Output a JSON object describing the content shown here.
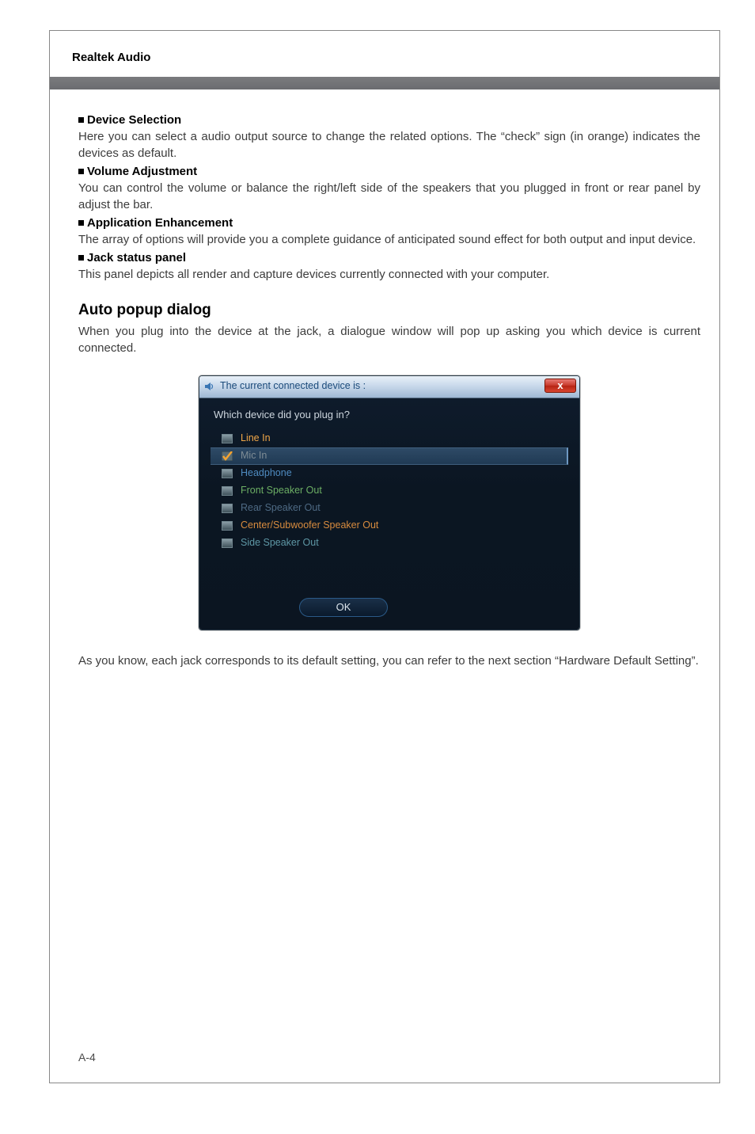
{
  "doc": {
    "title": "Realtek Audio",
    "pageNumber": "A-4"
  },
  "sections": {
    "deviceSelection": {
      "heading": "Device Selection",
      "body": "Here you can select a audio output source to change the related options. The “check” sign (in orange) indicates the devices as default."
    },
    "volumeAdjustment": {
      "heading": "Volume Adjustment",
      "body": "You can control the volume or balance the right/left side of the speakers that you plugged in front or rear panel by adjust the bar."
    },
    "applicationEnhancement": {
      "heading": "Application Enhancement",
      "body": "The array of options will provide you a complete guidance of anticipated sound effect for both output and input device."
    },
    "jackStatusPanel": {
      "heading": "Jack status panel",
      "body": "This panel depicts all render and capture devices currently connected with your computer."
    },
    "autoPopup": {
      "heading": "Auto popup dialog",
      "body": "When you plug into the device at the jack, a dialogue window will pop up asking you which device is current connected."
    },
    "closing": "As you know, each jack corresponds to its default setting, you can refer to the next section “Hardware Default Setting”."
  },
  "dialog": {
    "title": "The current connected device is :",
    "closeGlyph": "x",
    "prompt": "Which device did you plug in?",
    "okLabel": "OK",
    "devices": [
      {
        "label": "Line In",
        "colorClass": "dev-orange",
        "selected": false
      },
      {
        "label": "Mic In",
        "colorClass": "dev-gray",
        "selected": true
      },
      {
        "label": "Headphone",
        "colorClass": "dev-blue",
        "selected": false
      },
      {
        "label": "Front Speaker Out",
        "colorClass": "dev-green",
        "selected": false
      },
      {
        "label": "Rear Speaker Out",
        "colorClass": "dev-navy",
        "selected": false
      },
      {
        "label": "Center/Subwoofer Speaker Out",
        "colorClass": "dev-orange2",
        "selected": false
      },
      {
        "label": "Side Speaker Out",
        "colorClass": "dev-teal",
        "selected": false
      }
    ]
  }
}
